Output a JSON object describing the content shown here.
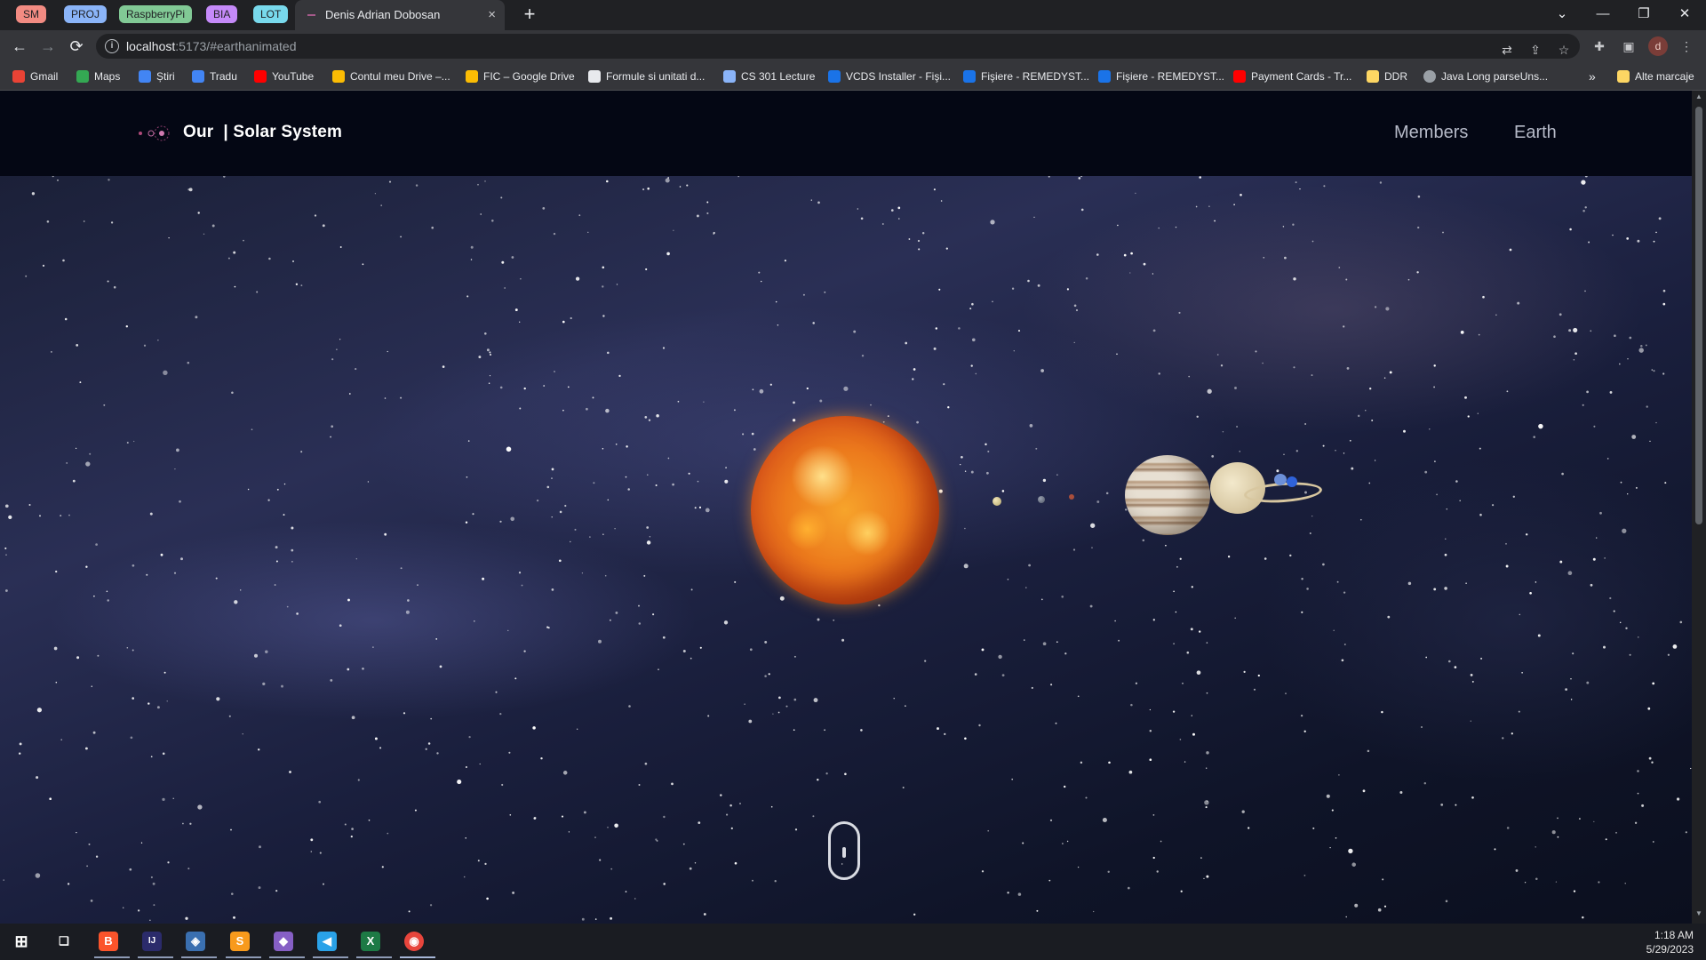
{
  "tabbar": {
    "groups": [
      {
        "label": "SM",
        "color": "#f28b82"
      },
      {
        "label": "PROJ",
        "color": "#8ab4f8"
      },
      {
        "label": "RaspberryPi",
        "color": "#81c995"
      },
      {
        "label": "BIA",
        "color": "#c58af9"
      },
      {
        "label": "LOT",
        "color": "#78d9ec"
      }
    ],
    "active_tab_title": "Denis Adrian Dobosan",
    "close_glyph": "×",
    "new_tab_glyph": "+",
    "window_controls": [
      "⌄",
      "—",
      "❐",
      "✕"
    ]
  },
  "toolbar": {
    "back": "←",
    "forward": "→",
    "reload": "⟳",
    "url_host": "localhost",
    "url_rest": ":5173/#earthanimated",
    "profile_initial": "d",
    "menu": "⋮"
  },
  "bookmarks": {
    "items": [
      {
        "label": "Gmail",
        "color": "#ea4335"
      },
      {
        "label": "Maps",
        "color": "#34a853"
      },
      {
        "label": "Știri",
        "color": "#4285f4"
      },
      {
        "label": "Tradu",
        "color": "#4285f4"
      },
      {
        "label": "YouTube",
        "color": "#ff0000"
      },
      {
        "label": "Contul meu Drive –...",
        "color": "#fbbc04"
      },
      {
        "label": "FIC – Google Drive",
        "color": "#fbbc04"
      },
      {
        "label": "Formule si unitati d...",
        "color": "#e8eaed"
      },
      {
        "label": "CS 301 Lecture",
        "color": "#8ab4f8"
      },
      {
        "label": "VCDS Installer - Fişi...",
        "color": "#1a73e8"
      },
      {
        "label": "Fişiere - REMEDYST...",
        "color": "#1a73e8"
      },
      {
        "label": "Fişiere - REMEDYST...",
        "color": "#1a73e8"
      },
      {
        "label": "Payment Cards - Tr...",
        "color": "#ff0000"
      },
      {
        "label": "DDR",
        "color": "#fdd663"
      },
      {
        "label": "Java Long parseUns...",
        "color": "#9aa0a6"
      }
    ],
    "overflow": "»",
    "other_bookmarks": "Alte marcaje"
  },
  "site": {
    "logo_text": "Our  | Solar System",
    "nav": [
      "Members",
      "Earth"
    ]
  },
  "taskbar": {
    "apps": [
      {
        "name": "windows-start",
        "glyph": "⊞",
        "color": "#ffffff"
      },
      {
        "name": "task-view",
        "glyph": "❏",
        "color": "#ffffff"
      },
      {
        "name": "brave",
        "glyph": "B",
        "color": "#fb542b"
      },
      {
        "name": "intellij",
        "glyph": "IJ",
        "color": "#2b2b6b"
      },
      {
        "name": "virtualbox",
        "glyph": "◈",
        "color": "#3a6fb0"
      },
      {
        "name": "sublime",
        "glyph": "S",
        "color": "#f89a1c"
      },
      {
        "name": "visual-studio",
        "glyph": "◆",
        "color": "#865fc5"
      },
      {
        "name": "vscode",
        "glyph": "◀",
        "color": "#2aa2e8"
      },
      {
        "name": "excel",
        "glyph": "X",
        "color": "#1d7a45"
      },
      {
        "name": "chrome",
        "glyph": "◉",
        "color": "#e8453c"
      }
    ],
    "time": "1:18 AM",
    "date": "5/29/2023"
  },
  "colors": {
    "page_bg": "#05070f",
    "header_bg": "#040714",
    "chrome_dark": "#202124",
    "chrome_mid": "#35363a",
    "sun": "#ec7a1c"
  }
}
